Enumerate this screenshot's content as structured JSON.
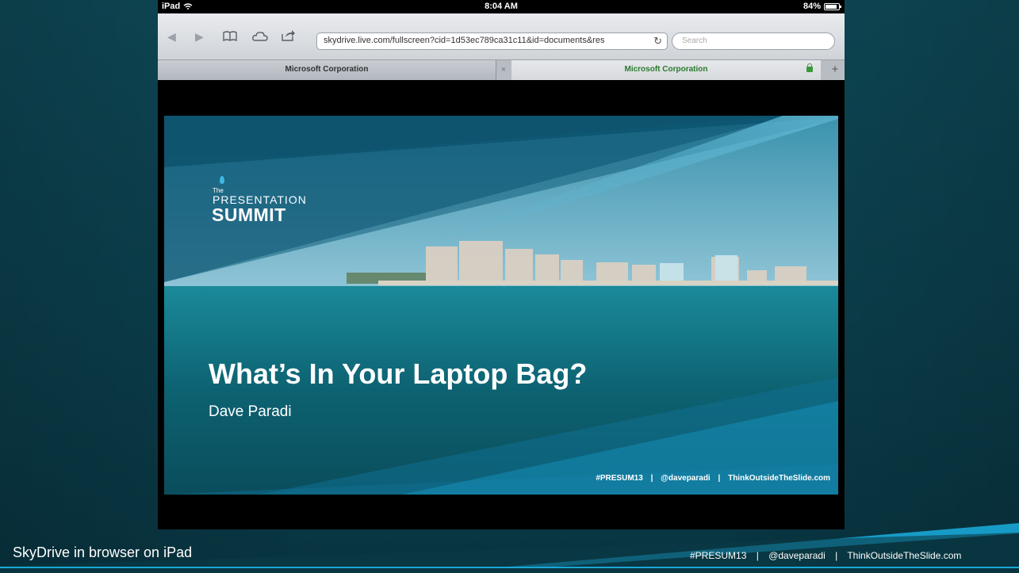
{
  "status_bar": {
    "device": "iPad",
    "time": "8:04 AM",
    "battery": "84%"
  },
  "browser": {
    "url": "skydrive.live.com/fullscreen?cid=1d53ec789ca31c11&id=documents&res",
    "search_placeholder": "Search",
    "tabs": [
      {
        "label": "Microsoft Corporation",
        "active": false
      },
      {
        "label": "Microsoft Corporation",
        "active": true
      }
    ],
    "close_tab": "×",
    "new_tab": "+"
  },
  "slide": {
    "logo": {
      "the": "The",
      "presentation": "PRESENTATION",
      "summit": "SUMMIT"
    },
    "title": "What’s In Your Laptop Bag?",
    "author": "Dave Paradi",
    "footer": {
      "hashtag": "#PRESUM13",
      "handle": "@daveparadi",
      "site": "ThinkOutsideTheSlide.com"
    }
  },
  "caption": "SkyDrive in browser on iPad",
  "footer": {
    "hashtag": "#PRESUM13",
    "handle": "@daveparadi",
    "site": "ThinkOutsideTheSlide.com",
    "separator": "|"
  },
  "colors": {
    "background": "#0b3f4c",
    "accent": "#1aa7d6",
    "secure_tab_text": "#2b7a2e"
  }
}
